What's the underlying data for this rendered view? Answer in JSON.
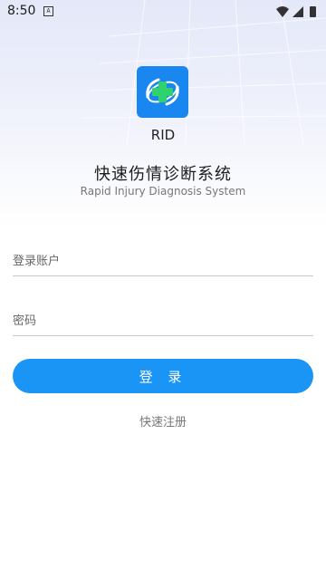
{
  "status_bar": {
    "time": "8:50",
    "notification_letter": "A",
    "icons": [
      "wifi-icon",
      "signal-icon",
      "battery-icon"
    ]
  },
  "app": {
    "short_name": "RID",
    "title": "快速伤情诊断系统",
    "subtitle": "Rapid Injury Diagnosis System",
    "logo_icon": "medical-cross-logo-icon"
  },
  "form": {
    "account_placeholder": "登录账户",
    "password_placeholder": "密码",
    "account_value": "",
    "password_value": ""
  },
  "actions": {
    "login_label": "登 录",
    "register_label": "快速注册"
  },
  "colors": {
    "accent": "#1a95f5",
    "logo_bg": "#1a86ef",
    "logo_cross": "#2fd36b"
  }
}
